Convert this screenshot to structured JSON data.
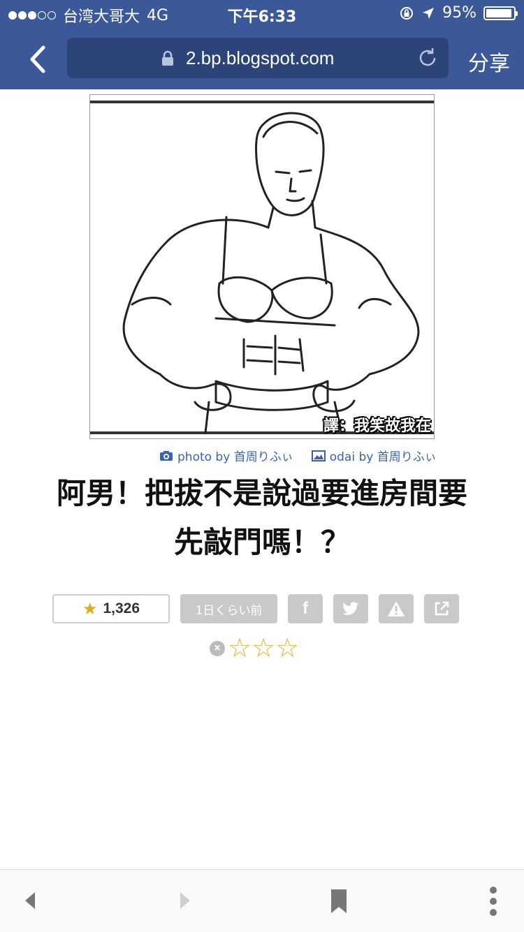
{
  "status_bar": {
    "carrier": "台湾大哥大",
    "network": "4G",
    "time": "下午6:33",
    "battery": "95%",
    "battery_level": 0.95
  },
  "nav": {
    "url": "2.bp.blogspot.com",
    "share_label": "分享"
  },
  "image": {
    "caption_overlay": "譯：我笑故我在"
  },
  "credits": {
    "photo": "photo by 首周りふぃ",
    "odai": "odai by 首周りふぃ"
  },
  "post": {
    "title_line1": "阿男！把拔不是說過要進房間要",
    "title_line2": "先敲門嗎！？"
  },
  "actions": {
    "likes": "1,326",
    "time_ago": "1日くらい前",
    "facebook_label": "f"
  },
  "rating": {
    "stars": "☆☆☆",
    "clear_label": "×"
  },
  "colors": {
    "header_bg": "#3b5998",
    "link": "#3a62b4",
    "star": "#e2a81e",
    "button_gray": "#c9c9c9"
  },
  "icons": [
    "back-arrow-icon",
    "lock-icon",
    "reload-icon",
    "camera-icon",
    "image-icon",
    "star-icon",
    "facebook-icon",
    "twitter-icon",
    "warning-icon",
    "external-link-icon",
    "clear-icon",
    "nav-back-icon",
    "nav-forward-icon",
    "bookmark-icon",
    "more-icon"
  ]
}
